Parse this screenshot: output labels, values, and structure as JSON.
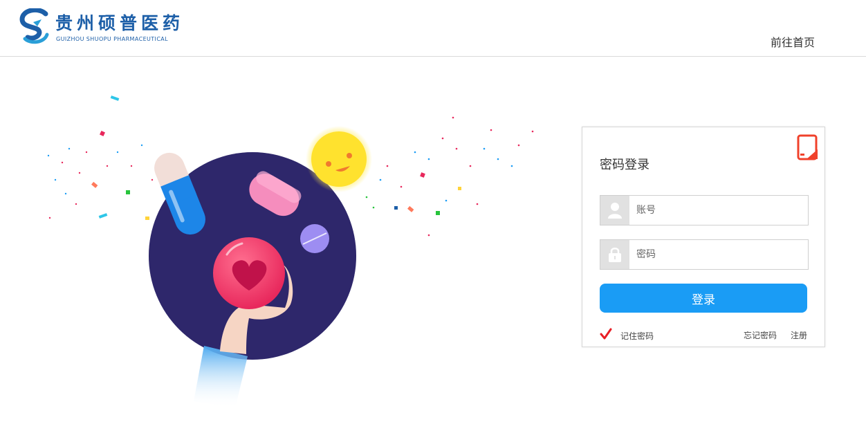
{
  "header": {
    "logo_cn": "贵州硕普医药",
    "logo_en": "GUIZHOU SHUOPU PHARMACEUTICAL",
    "home_link": "前往首页"
  },
  "login": {
    "title": "密码登录",
    "account_placeholder": "账号",
    "password_placeholder": "密码",
    "login_button": "登录",
    "remember_label": "记住密码",
    "remember_checked": true,
    "forgot_link": "忘记密码",
    "register_link": "注册"
  },
  "icons": {
    "logo_mark": "shuopu-logo-icon",
    "user": "user-icon",
    "lock": "lock-icon",
    "switch_mode": "phone-login-switch-icon",
    "checkbox": "checkmark-icon"
  },
  "colors": {
    "brand_blue": "#1d5fa8",
    "button_blue": "#1a9cf5",
    "switch_red": "#f0412b",
    "check_red": "#e81e25"
  }
}
